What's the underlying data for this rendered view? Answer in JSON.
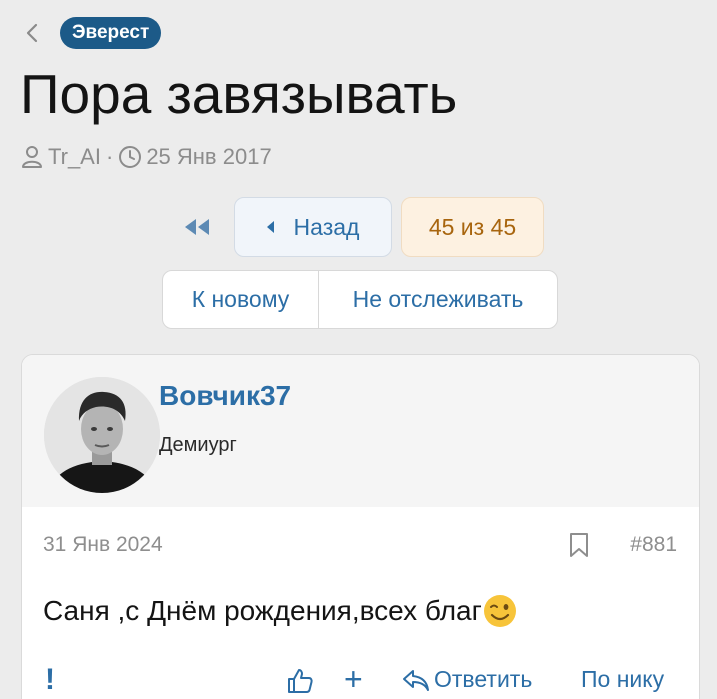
{
  "header": {
    "back_icon": "chevron-left-icon",
    "breadcrumb": "Эверест",
    "title": "Пора завязывать",
    "author": "Tr_AI",
    "separator": "·",
    "date": "25 Янв 2017"
  },
  "pagination": {
    "first_icon": "double-chevron-left-icon",
    "prev_label": "Назад",
    "page_counter": "45 из 45"
  },
  "thread_actions": {
    "to_new_label": "К новому",
    "unwatch_label": "Не отслеживать"
  },
  "post": {
    "username": "Вовчик37",
    "role": "Демиург",
    "date": "31 Янв 2024",
    "number": "#881",
    "text": "Саня ,с Днём рождения,всех благ",
    "emoji": "winking-face-emoji",
    "footer": {
      "report_label": "!",
      "plus_label": "+",
      "reply_label": "Ответить",
      "by_nick_label": "По нику"
    }
  },
  "colors": {
    "accent": "#2c6ea6",
    "breadcrumb_bg": "#1c5a88",
    "counter_text": "#a8650e",
    "counter_bg": "#fdf1e1",
    "page_bg": "#ececec"
  }
}
